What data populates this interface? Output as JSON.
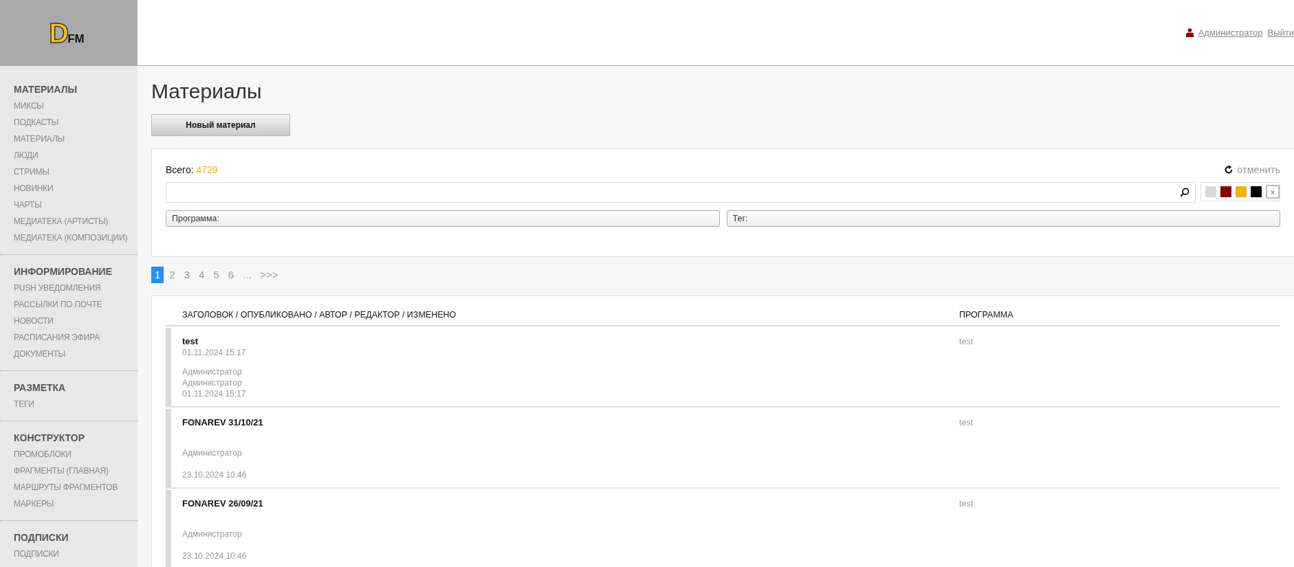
{
  "logo": {
    "letter": "D",
    "text": "FM"
  },
  "user": {
    "name": "Администратор",
    "logout": "Выйти"
  },
  "sidebar": {
    "sections": [
      {
        "title": "МАТЕРИАЛЫ",
        "items": [
          "МИКСЫ",
          "ПОДКАСТЫ",
          "МАТЕРИАЛЫ",
          "ЛЮДИ",
          "СТРИМЫ",
          "НОВИНКИ",
          "ЧАРТЫ",
          "МЕДИАТЕКА (АРТИСТЫ)",
          "МЕДИАТЕКА (КОМПОЗИЦИИ)"
        ]
      },
      {
        "title": "ИНФОРМИРОВАНИЕ",
        "items": [
          "PUSH УВЕДОМЛЕНИЯ",
          "РАССЫЛКИ ПО ПОЧТЕ",
          "НОВОСТИ",
          "РАСПИСАНИЯ ЭФИРА",
          "ДОКУМЕНТЫ"
        ]
      },
      {
        "title": "РАЗМЕТКА",
        "items": [
          "ТЕГИ"
        ]
      },
      {
        "title": "КОНСТРУКТОР",
        "items": [
          "ПРОМОБЛОКИ",
          "ФРАГМЕНТЫ (ГЛАВНАЯ)",
          "МАРШРУТЫ ФРАГМЕНТОВ",
          "МАРКЕРЫ"
        ]
      },
      {
        "title": "ПОДПИСКИ",
        "items": [
          "ПОДПИСКИ"
        ]
      }
    ]
  },
  "page_title": "Материалы",
  "new_button": "Новый материал",
  "filters": {
    "total_label": "Всего:",
    "total": "4729",
    "reset": "отменить",
    "colors": [
      {
        "color": "#d9d9d9"
      },
      {
        "color": "#8b0000"
      },
      {
        "color": "#f0b400"
      },
      {
        "color": "#000000"
      }
    ],
    "clear_colors": "x",
    "program_label": "Программа:",
    "tag_label": "Тег:"
  },
  "pagination": [
    {
      "label": "1",
      "selected": true
    },
    {
      "label": "2",
      "selected": false
    },
    {
      "label": "3",
      "selected": false
    },
    {
      "label": "4",
      "selected": false
    },
    {
      "label": "5",
      "selected": false
    },
    {
      "label": "6",
      "selected": false
    },
    {
      "label": "...",
      "selected": false
    },
    {
      "label": ">>>",
      "selected": false
    }
  ],
  "table": {
    "columns": [
      "ЗАГОЛОВОК / ОПУБЛИКОВАНО / АВТОР / РЕДАКТОР / ИЗМЕНЕНО",
      "ПРОГРАММА"
    ],
    "rows": [
      {
        "title": "test",
        "published": "01.11.2024 15:17",
        "author": "Администратор",
        "editor": "Администратор",
        "modified": "01.11.2024 15:17",
        "program": "test"
      },
      {
        "title": "FONAREV 31/10/21",
        "author": "Администратор",
        "modified": "23.10.2024 10:46",
        "program": "test"
      },
      {
        "title": "FONAREV 26/09/21",
        "author": "Администратор",
        "modified": "23.10.2024 10:46",
        "program": "test"
      }
    ]
  }
}
